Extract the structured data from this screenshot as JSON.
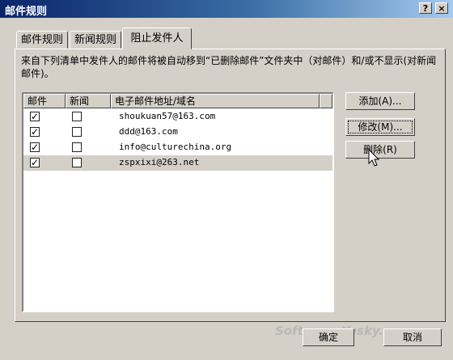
{
  "window": {
    "title": "邮件规则",
    "help_label": "?",
    "close_label": "×"
  },
  "tabs": [
    {
      "label": "邮件规则"
    },
    {
      "label": "新闻规则"
    },
    {
      "label": "阻止发件人"
    }
  ],
  "description": "来自下列清单中发件人的邮件将被自动移到“已删除邮件”文件夹中（对邮件）和/或不显示(对新闻邮件)。",
  "list": {
    "columns": [
      "邮件",
      "新闻",
      "电子邮件地址/域名"
    ],
    "rows": [
      {
        "mail": true,
        "news": false,
        "address": "shoukuan57@163.com"
      },
      {
        "mail": true,
        "news": false,
        "address": "ddd@163.com"
      },
      {
        "mail": true,
        "news": false,
        "address": "info@culturechina.org"
      },
      {
        "mail": true,
        "news": false,
        "address": "zspxixi@263.net"
      }
    ],
    "check_mark": "✓"
  },
  "buttons": {
    "add": "添加(A)...",
    "modify": "修改(M)...",
    "delete": "删除(R)",
    "ok": "确定",
    "cancel": "取消"
  },
  "watermark": "Software.Yesky.com"
}
